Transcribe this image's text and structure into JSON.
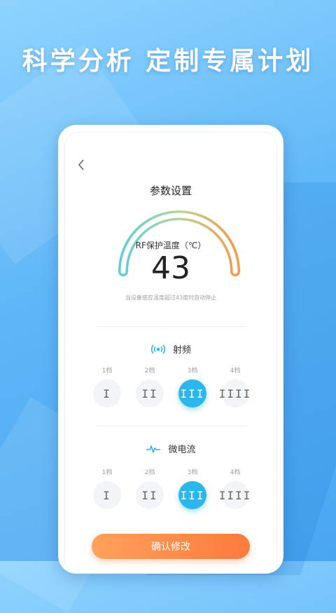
{
  "headline": "科学分析 定制专属计划",
  "page": {
    "title": "参数设置",
    "back_icon": "chevron-left-icon"
  },
  "gauge": {
    "label": "RF保护温度（℃）",
    "value": "43",
    "hint": "当设备感应温度超过43度时自动停止",
    "colors": {
      "start": "#5fd0cf",
      "end": "#f39c4a"
    }
  },
  "sections": [
    {
      "title": "射频",
      "icon": "radio-wave-icon",
      "levels": [
        {
          "label": "1档",
          "glyph": "I"
        },
        {
          "label": "2档",
          "glyph": "II"
        },
        {
          "label": "3档",
          "glyph": "III"
        },
        {
          "label": "4档",
          "glyph": "IIII"
        }
      ],
      "selected_level": "3档"
    },
    {
      "title": "微电流",
      "icon": "pulse-wave-icon",
      "levels": [
        {
          "label": "1档",
          "glyph": "I"
        },
        {
          "label": "2档",
          "glyph": "II"
        },
        {
          "label": "3档",
          "glyph": "III"
        },
        {
          "label": "4档",
          "glyph": "IIII"
        }
      ],
      "selected_level": "3档"
    }
  ],
  "confirm_button": "确认修改",
  "colors": {
    "accent": "#2cb6ec",
    "confirm_start": "#ffa15c",
    "confirm_end": "#ff7a3d"
  }
}
